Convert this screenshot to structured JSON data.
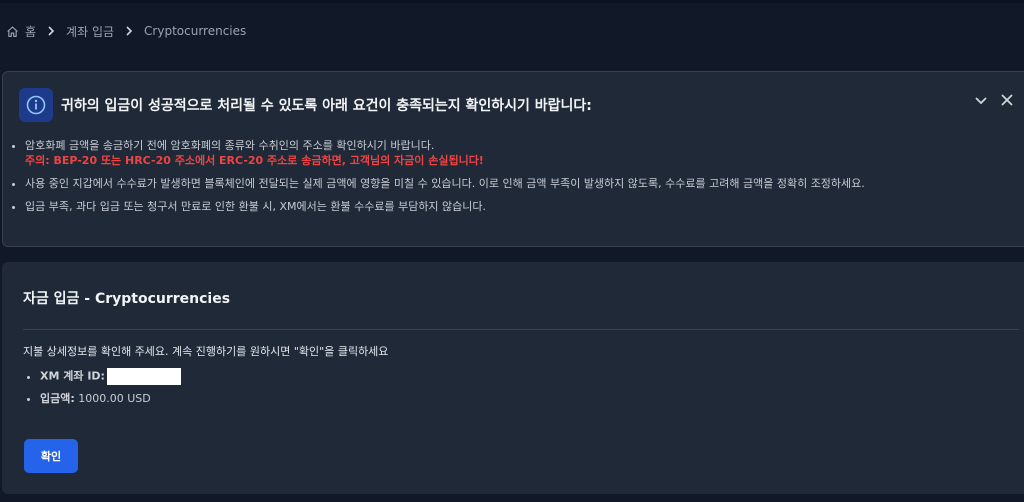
{
  "breadcrumb": {
    "home": "홈",
    "deposit": "계좌 입금",
    "current": "Cryptocurrencies"
  },
  "notice": {
    "title": "귀하의 입금이 성공적으로 처리될 수 있도록 아래 요건이 충족되는지 확인하시기 바랍니다:",
    "items": [
      "암호화폐 금액을 송금하기 전에 암호화폐의 종류와 수취인의 주소를 확인하시기 바랍니다.",
      "사용 중인 지갑에서 수수료가 발생하면 블록체인에 전달되는 실제 금액에 영향을 미칠 수 있습니다. 이로 인해 금액 부족이 발생하지 않도록, 수수료를 고려해 금액을 정확히 조정하세요.",
      "입금 부족, 과다 입금 또는 청구서 만료로 인한 환불 시, XM에서는 환불 수수료를 부담하지 않습니다."
    ],
    "warning": "주의: BEP-20 또는 HRC-20 주소에서 ERC-20 주소로 송금하면, 고객님의 자금이 손실됩니다!",
    "icon": "info-icon",
    "accent": "#1e3a8a"
  },
  "deposit": {
    "title": "자금 입금 - Cryptocurrencies",
    "instruction": "지불 상세정보를 확인해 주세요. 계속 진행하기를 원하시면 \"확인\"을 클릭하세요",
    "account_label": "XM 계좌 ID:",
    "amount_label": "입금액:",
    "amount_value": "1000.00 USD",
    "confirm_label": "확인",
    "button_color": "#2563eb"
  }
}
